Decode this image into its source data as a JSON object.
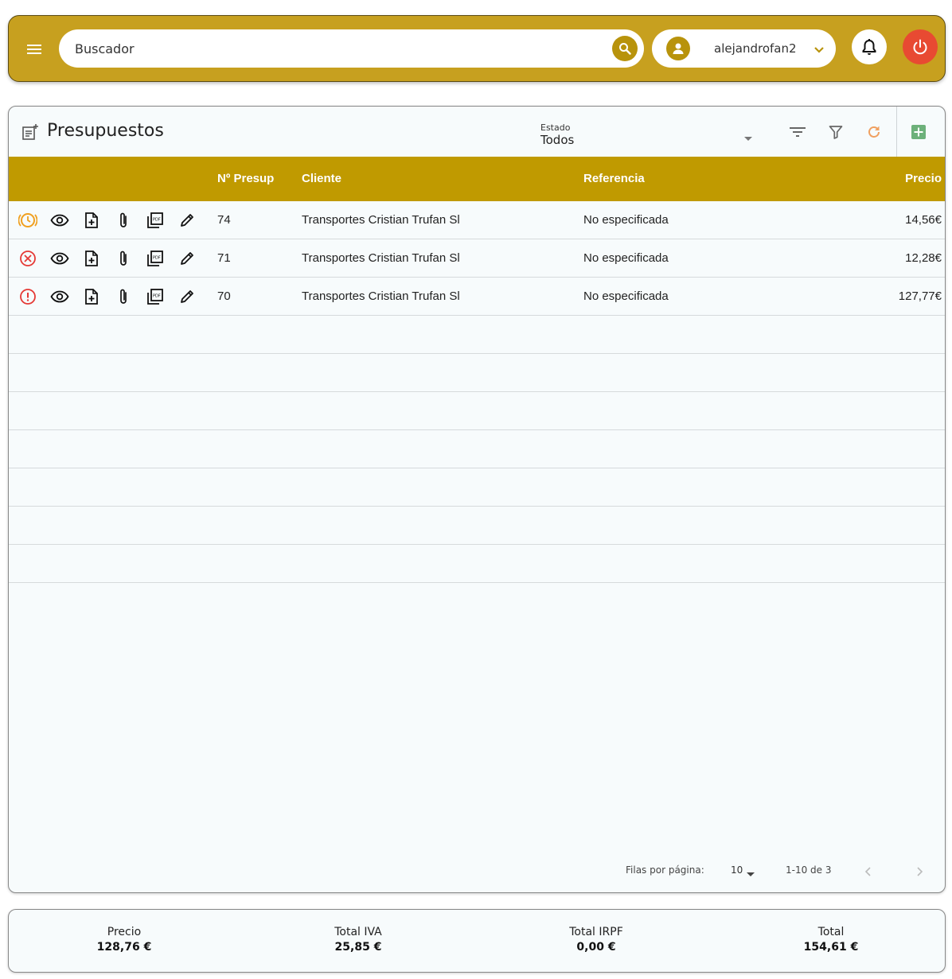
{
  "header": {
    "search_placeholder": "Buscador",
    "username": "alejandrofan2"
  },
  "page": {
    "title": "Presupuestos",
    "estado_label": "Estado",
    "estado_value": "Todos"
  },
  "table": {
    "columns": [
      "Nº Presup",
      "Cliente",
      "Referencia",
      "Precio"
    ],
    "rows": [
      {
        "status": "clock-icon",
        "number": "74",
        "client": "Transportes Cristian Trufan Sl",
        "reference": "No especificada",
        "price": "14,56€"
      },
      {
        "status": "cancel-icon",
        "number": "71",
        "client": "Transportes Cristian Trufan Sl",
        "reference": "No especificada",
        "price": "12,28€"
      },
      {
        "status": "alert-icon",
        "number": "70",
        "client": "Transportes Cristian Trufan Sl",
        "reference": "No especificada",
        "price": "127,77€"
      }
    ]
  },
  "pagination": {
    "rows_per_page_label": "Filas por página:",
    "rows_per_page": "10",
    "range": "1-10 de 3"
  },
  "totals": [
    {
      "label": "Precio",
      "value": "128,76 €"
    },
    {
      "label": "Total IVA",
      "value": "25,85 €"
    },
    {
      "label": "Total IRPF",
      "value": "0,00 €"
    },
    {
      "label": "Total",
      "value": "154,61 €"
    }
  ],
  "colors": {
    "header_bg": "#c7a01f",
    "table_header_bg": "#c09a00",
    "power": "#e84a32",
    "accent_green": "#5cae6a"
  }
}
